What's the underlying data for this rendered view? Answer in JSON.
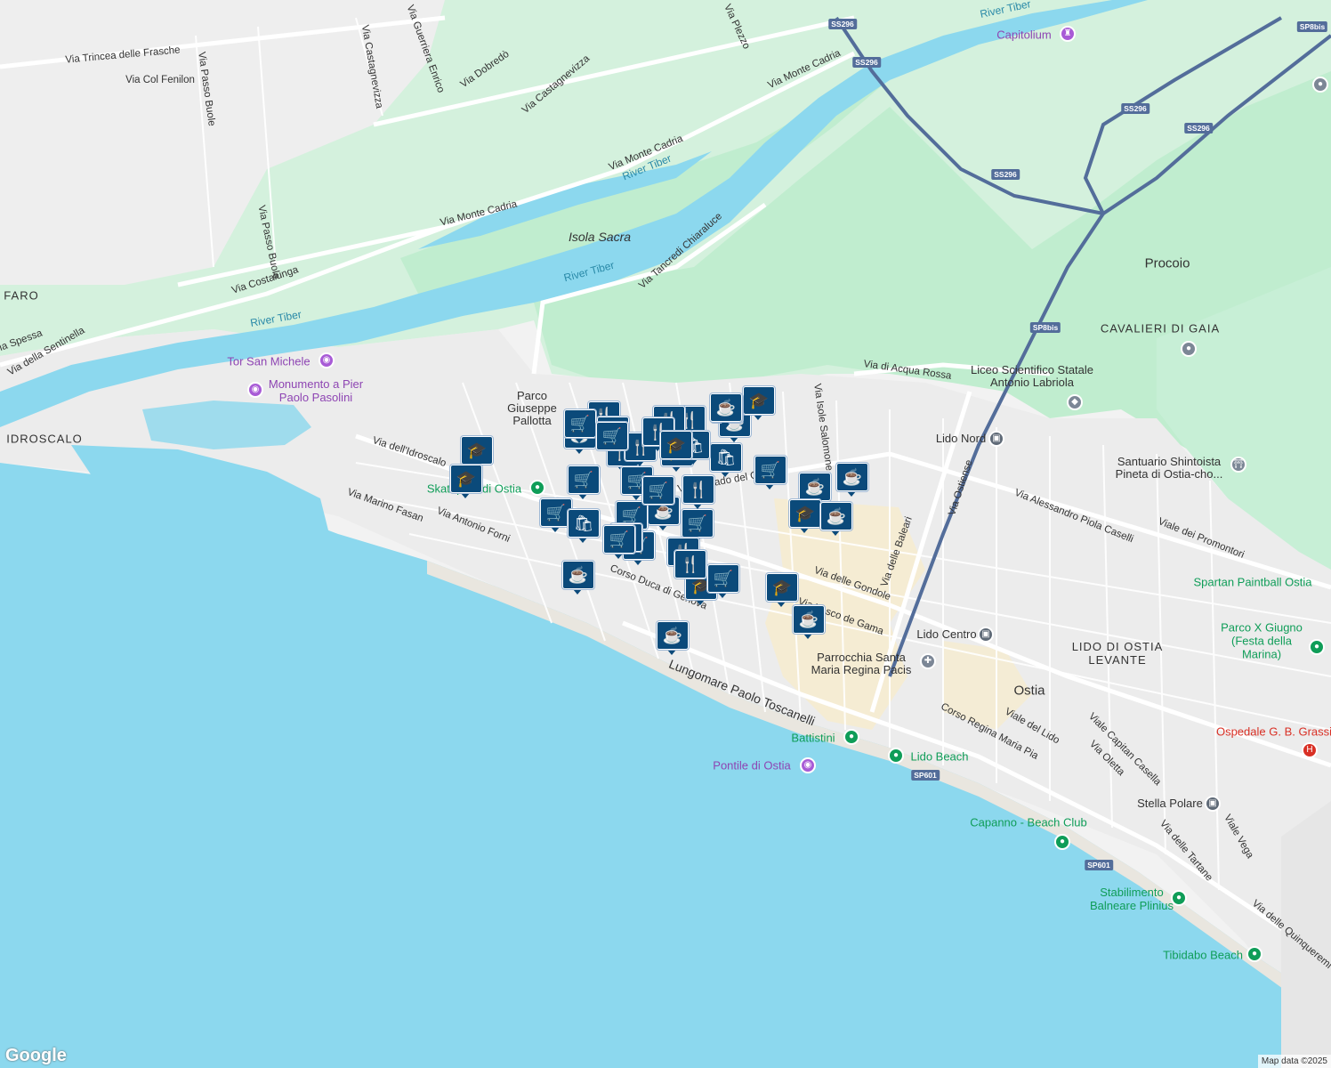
{
  "map": {
    "attribution": "Map data ©2025",
    "logo": "Google",
    "colors": {
      "sea": "#8cd8ee",
      "river": "#8cd8ee",
      "park": "#c7efd6",
      "land": "#f2f2f2",
      "marker": "#0b4a7a",
      "highway": "#536d9a"
    }
  },
  "labels": {
    "roads": [
      "Via Trincea delle Frasche",
      "Via Col Fenilon",
      "Via Passo Buole",
      "Via Castagnevizza",
      "Via Guerriera Enrico",
      "Via Dobredò",
      "Via Castagnevizza",
      "Via Plezzo",
      "Via Monte Cadria",
      "Via Monte Cadria",
      "Via Monte Cadria",
      "Via Passo Buole",
      "Via Costalunga",
      "Via Tancredi Chiaraluce",
      "Via di Acqua Rossa",
      "Via Isole Salomone",
      "Via dell'Idroscalo",
      "Via Marino Fasan",
      "Via Antonio Forni",
      "Corso Duca di Genova",
      "Via delle Gondole",
      "Via delle Baleari",
      "Via Vasco de Gama",
      "Via Ostiense",
      "Via Alessandro Piola Caselli",
      "Viale dei Promontori",
      "Lungomare Paolo Toscanelli",
      "Corso Regina Maria Pia",
      "Viale del Lido",
      "Viale Capitan Casella",
      "Via Oletta",
      "Via delle Tartane",
      "Viale Vega",
      "Via delle Quinqueremi",
      "Via della Sentinella",
      "Via Spessa",
      "Via Corrado del Greco"
    ],
    "water": [
      "River Tiber",
      "River Tiber",
      "River Tiber",
      "River Tiber"
    ],
    "areas": [
      "Isola Sacra"
    ],
    "districts": [
      "FARO",
      "IDROSCALO",
      "LIDO DI OSTIA LEVANTE",
      "CAVALIERI DI GAIA"
    ],
    "towns": [
      "Procoio",
      "Ostia"
    ],
    "pois": {
      "capitolium": "Capitolium",
      "tor_san_michele": "Tor San Michele",
      "monumento": "Monumento a Pier Paolo Pasolini",
      "parco_pallotta": "Parco Giuseppe Pallotta",
      "skatepark": "Skatepark di Ostia",
      "liceo": "Liceo Scientifico Statale Antonio Labriola",
      "lido_nord": "Lido Nord",
      "santuario": "Santuario Shintoista Pineta di Ostia-cho...",
      "spartan": "Spartan Paintball Ostia",
      "parco_x": "Parco X Giugno (Festa della Marina)",
      "lido_centro": "Lido Centro",
      "parrocchia": "Parrocchia Santa Maria Regina Pacis",
      "battistini": "Battistini",
      "lido_beach": "Lido Beach",
      "pontile": "Pontile di Ostia",
      "ospedale": "Ospedale G. B. Grassi",
      "stella_polare": "Stella Polare",
      "capanno": "Capanno - Beach Club",
      "stabilimento": "Stabilimento Balneare Plinius",
      "tibidabo": "Tibidabo Beach"
    },
    "shields": [
      "SS296",
      "SS296",
      "SS296",
      "SS296",
      "SS296",
      "SP8bis",
      "SP8bis",
      "SP601",
      "SP601"
    ]
  },
  "markers": [
    {
      "type": "education"
    },
    {
      "type": "education"
    },
    {
      "type": "cafe"
    },
    {
      "type": "shopping"
    },
    {
      "type": "restaurant"
    },
    {
      "type": "restaurant"
    },
    {
      "type": "cafe"
    },
    {
      "type": "education"
    },
    {
      "type": "shopping"
    },
    {
      "type": "restaurant"
    },
    {
      "type": "cafe"
    },
    {
      "type": "restaurant"
    },
    {
      "type": "restaurant"
    },
    {
      "type": "education"
    },
    {
      "type": "shopping"
    },
    {
      "type": "shopping"
    },
    {
      "type": "restaurant"
    },
    {
      "type": "restaurant"
    },
    {
      "type": "bag"
    },
    {
      "type": "shopping"
    },
    {
      "type": "cafe"
    },
    {
      "type": "education"
    },
    {
      "type": "cafe"
    },
    {
      "type": "cafe"
    },
    {
      "type": "shopping"
    },
    {
      "type": "shopping"
    },
    {
      "type": "bag"
    },
    {
      "type": "shopping"
    },
    {
      "type": "cafe"
    },
    {
      "type": "restaurant"
    },
    {
      "type": "shopping"
    },
    {
      "type": "shopping"
    },
    {
      "type": "restaurant"
    },
    {
      "type": "cafe"
    },
    {
      "type": "shopping"
    },
    {
      "type": "restaurant"
    },
    {
      "type": "education"
    },
    {
      "type": "shopping"
    },
    {
      "type": "cafe"
    },
    {
      "type": "education"
    },
    {
      "type": "cafe"
    },
    {
      "type": "cafe"
    },
    {
      "type": "bag"
    },
    {
      "type": "shopping"
    },
    {
      "type": "education"
    }
  ],
  "marker_icons": {
    "education": "🎓",
    "cafe": "☕",
    "shopping": "🛒",
    "restaurant": "🍴",
    "bag": "🛍"
  }
}
